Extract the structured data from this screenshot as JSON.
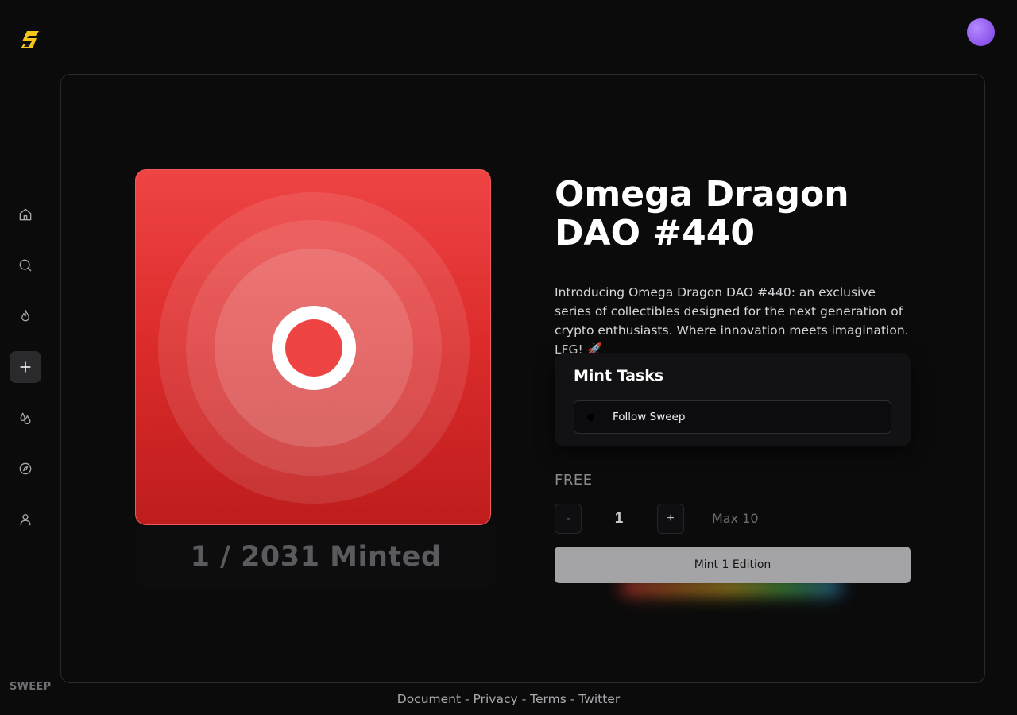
{
  "brand": {
    "logo_icon": "sweep-lightning-logo",
    "wordmark": "SWEEP",
    "accent_color": "#f5c518"
  },
  "user": {
    "avatar_color": "#9a66f2"
  },
  "sidebar": {
    "items": [
      {
        "icon": "home-icon",
        "label": "Home",
        "active": false
      },
      {
        "icon": "search-icon",
        "label": "Search",
        "active": false
      },
      {
        "icon": "flame-icon",
        "label": "Trending",
        "active": false
      },
      {
        "icon": "plus-icon",
        "label": "Create",
        "active": true
      },
      {
        "icon": "drops-icon",
        "label": "Drops",
        "active": false
      },
      {
        "icon": "compass-icon",
        "label": "Explore",
        "active": false
      },
      {
        "icon": "user-icon",
        "label": "Profile",
        "active": false
      }
    ]
  },
  "collection": {
    "title": "Omega Dragon DAO #440",
    "description": "Introducing Omega Dragon DAO #440: an exclusive series of collectibles designed for the next generation of crypto enthusiasts. Where innovation meets imagination. LFG! 🚀",
    "minted_text": "1 / 2031 Minted",
    "art_color": "#ef4444"
  },
  "mint_tasks": {
    "title": "Mint Tasks",
    "tasks": [
      {
        "label": "Follow Sweep"
      }
    ]
  },
  "mint": {
    "price": "FREE",
    "decrement_label": "-",
    "quantity": "1",
    "increment_label": "+",
    "max_label": "Max 10",
    "button_label": "Mint 1 Edition"
  },
  "footer": {
    "links": [
      "Document",
      "Privacy",
      "Terms",
      "Twitter"
    ],
    "separator": "-"
  }
}
